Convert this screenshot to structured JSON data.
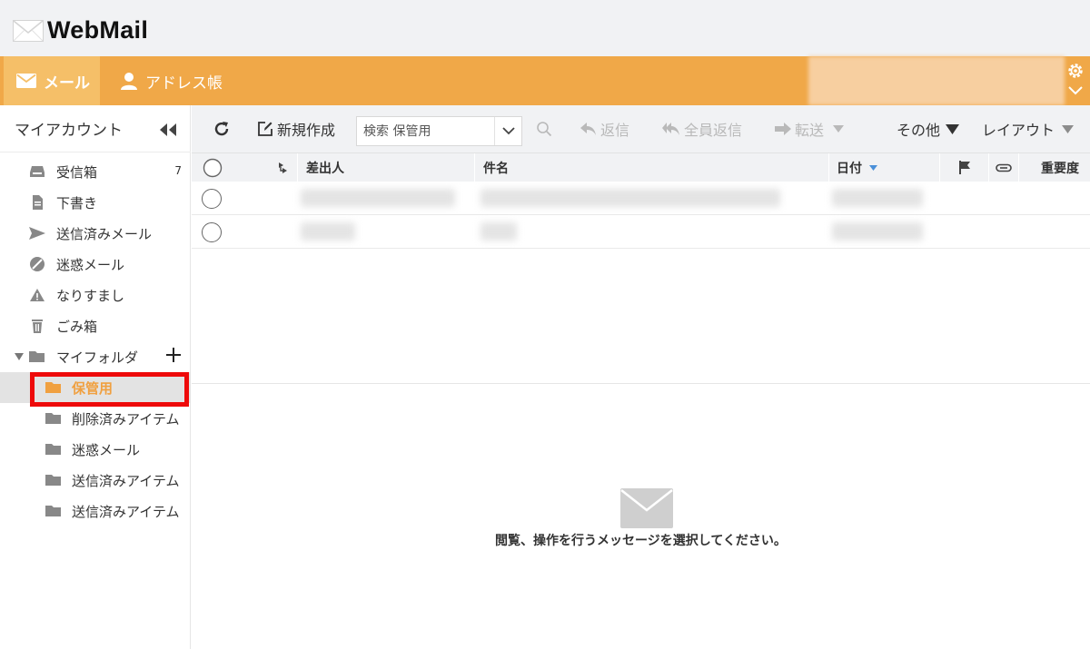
{
  "app": {
    "logo_text": "WebMail"
  },
  "nav": {
    "tabs": [
      {
        "label": "メール",
        "icon": "envelope-icon",
        "active": true
      },
      {
        "label": "アドレス帳",
        "icon": "person-icon",
        "active": false
      }
    ],
    "settings_icon": "gear-icon",
    "menu_icon": "chevron-down-icon"
  },
  "sidebar": {
    "title": "マイアカウント",
    "folders": [
      {
        "label": "受信箱",
        "count": "7",
        "icon": "inbox-icon"
      },
      {
        "label": "下書き",
        "icon": "draft-icon"
      },
      {
        "label": "送信済みメール",
        "icon": "send-icon"
      },
      {
        "label": "迷惑メール",
        "icon": "block-icon"
      },
      {
        "label": "なりすまし",
        "icon": "warning-icon"
      },
      {
        "label": "ごみ箱",
        "icon": "trash-icon"
      },
      {
        "label": "マイフォルダ",
        "icon": "folder-icon"
      }
    ],
    "subfolders": [
      {
        "label": "保管用",
        "selected": true
      },
      {
        "label": "削除済みアイテム"
      },
      {
        "label": "迷惑メール"
      },
      {
        "label": "送信済みアイテム"
      },
      {
        "label": "送信済みアイテム"
      }
    ]
  },
  "toolbar": {
    "compose": "新規作成",
    "search_placeholder": "検索 保管用",
    "reply": "返信",
    "reply_all": "全員返信",
    "forward": "転送",
    "more": "その他",
    "layout": "レイアウト"
  },
  "list": {
    "columns": {
      "from": "差出人",
      "subject": "件名",
      "date": "日付",
      "importance": "重要度"
    }
  },
  "preview": {
    "message": "閲覧、操作を行うメッセージを選択してください。"
  },
  "colors": {
    "accent": "#f0a848",
    "selected_text": "#f0a040",
    "highlight": "#ee0a0a"
  }
}
